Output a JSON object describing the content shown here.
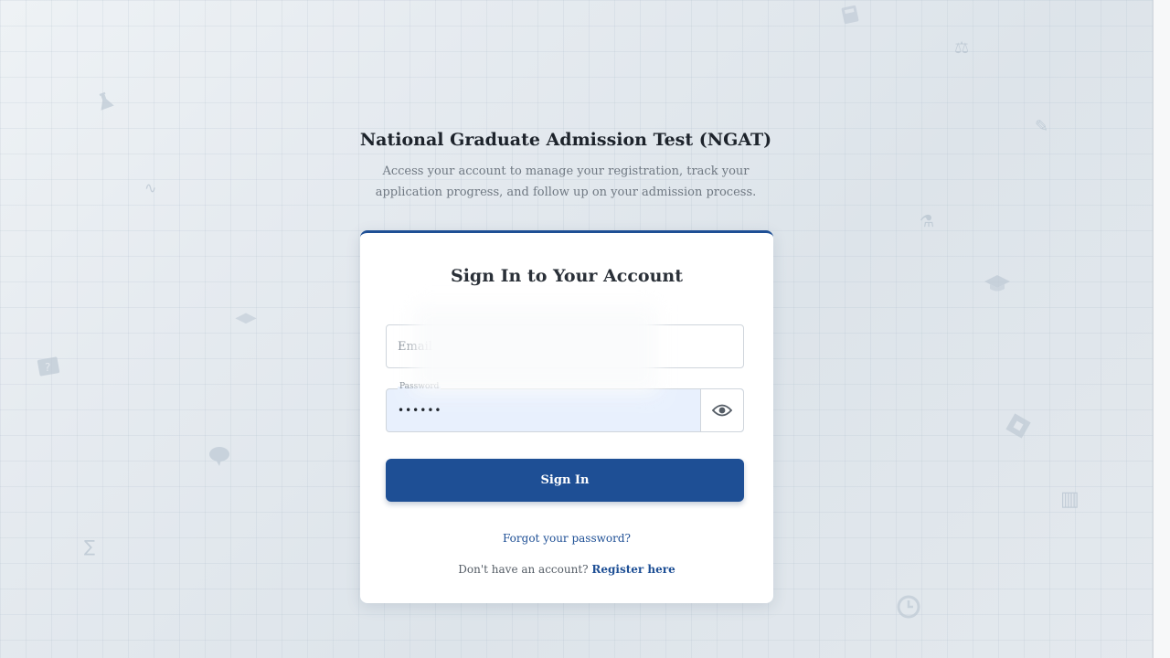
{
  "header": {
    "title": "National Graduate Admission Test (NGAT)",
    "subtitle": "Access your account to manage your registration, track your application progress, and follow up on your admission process."
  },
  "card": {
    "title": "Sign In to Your Account",
    "email": {
      "placeholder": "Email",
      "value": ""
    },
    "password": {
      "label": "Password",
      "value": "••••••",
      "toggle_icon": "eye-icon"
    },
    "signin_label": "Sign In",
    "forgot_label": "Forgot your password?",
    "register_prompt": "Don't have an account?",
    "register_label": "Register here"
  },
  "colors": {
    "accent": "#1e4f95",
    "autofill": "#e8f0fd"
  },
  "decorative_icons": [
    "flask-icon",
    "book-icon",
    "chat-icon",
    "graduation-cap-icon",
    "calculator-icon",
    "puzzle-icon",
    "pencil-icon",
    "clock-icon",
    "ruler-icon",
    "scale-icon"
  ]
}
